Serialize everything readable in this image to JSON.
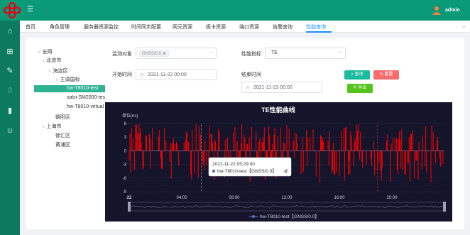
{
  "header": {
    "username": "admin"
  },
  "tabs": [
    {
      "label": "首页"
    },
    {
      "label": "角色管理"
    },
    {
      "label": "服务器资源监控"
    },
    {
      "label": "时间同步配置"
    },
    {
      "label": "网元资源"
    },
    {
      "label": "板卡资源"
    },
    {
      "label": "端口资源"
    },
    {
      "label": "告警查询"
    },
    {
      "label": "性能查询",
      "active": true
    }
  ],
  "tree": [
    {
      "label": "全网",
      "level": 0,
      "arrow": "v"
    },
    {
      "label": "北京市",
      "level": 1,
      "arrow": "v"
    },
    {
      "label": "海淀区",
      "level": 2,
      "arrow": "v"
    },
    {
      "label": "主调国标",
      "level": 3,
      "arrow": "v"
    },
    {
      "label": "hw-T8010-test",
      "level": 4,
      "selected": true
    },
    {
      "label": "salsi-SM2000-tes",
      "level": 4
    },
    {
      "label": "hw-T8010-virtual",
      "level": 4
    },
    {
      "label": "朝阳区",
      "level": 2
    },
    {
      "label": "上海市",
      "level": 1,
      "arrow": "v"
    },
    {
      "label": "徐汇区",
      "level": 2
    },
    {
      "label": "黄浦区",
      "level": 2
    }
  ],
  "form": {
    "monitor_label": "监测对象",
    "monitor_tag": "GNSS/0.0",
    "metric_label": "性能指标",
    "metric_value": "TE",
    "start_label": "开始时间",
    "start_value": "2021-11-22 00:00",
    "end_label": "结束时间",
    "end_value": "2021-11-23 00:00",
    "query_btn": "查询",
    "reset_btn": "重置",
    "export_btn": "导出"
  },
  "chart_data": {
    "type": "line",
    "title": "TE性能曲线",
    "ylabel": "单位(ns)",
    "ylim": [
      -9,
      6
    ],
    "yticks": [
      "6",
      "3",
      "0",
      "-3",
      "-6",
      "-9"
    ],
    "xticks": [
      "22",
      "04:00",
      "08:00",
      "12:00",
      "16:00",
      "20:00"
    ],
    "legend": "hw-T8010-test【GNSS/0.0】",
    "tooltip": {
      "time": "2021-11-22 05:29:00",
      "series": "hw-T8010-test【GNSS/0.0】",
      "value": "-2"
    },
    "colors": {
      "line": "#5470c6",
      "above": "#ff0000",
      "below": "#ff0000",
      "bg": "#14142b"
    }
  }
}
